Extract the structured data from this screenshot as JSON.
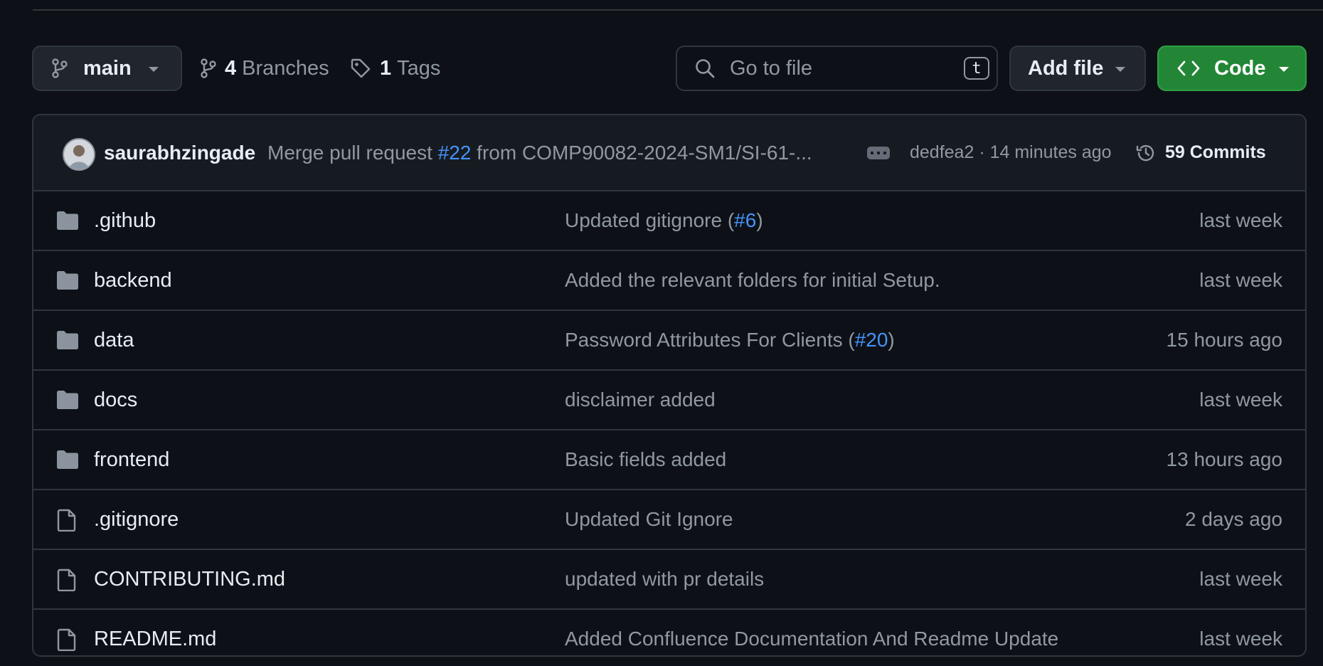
{
  "toolbar": {
    "branch": {
      "label": "main"
    },
    "branches": {
      "count": "4",
      "label": "Branches"
    },
    "tags": {
      "count": "1",
      "label": "Tags"
    },
    "search": {
      "placeholder": "Go to file",
      "shortcut": "t"
    },
    "add_file": {
      "label": "Add file"
    },
    "code": {
      "label": "Code"
    }
  },
  "latest_commit": {
    "author": "saurabhzingade",
    "message_prefix": "Merge pull request ",
    "pr": "#22",
    "message_suffix": " from COMP90082-2024-SM1/SI-61-...",
    "meta": "dedfea2 · 14 minutes ago",
    "commits": "59 Commits"
  },
  "files": [
    {
      "type": "dir",
      "name": ".github",
      "commit_prefix": "Updated gitignore (",
      "pr": "#6",
      "commit_suffix": ")",
      "time": "last week"
    },
    {
      "type": "dir",
      "name": "backend",
      "commit_prefix": "Added the relevant folders for initial Setup.",
      "pr": "",
      "commit_suffix": "",
      "time": "last week"
    },
    {
      "type": "dir",
      "name": "data",
      "commit_prefix": "Password Attributes For Clients (",
      "pr": "#20",
      "commit_suffix": ")",
      "time": "15 hours ago"
    },
    {
      "type": "dir",
      "name": "docs",
      "commit_prefix": "disclaimer added",
      "pr": "",
      "commit_suffix": "",
      "time": "last week"
    },
    {
      "type": "dir",
      "name": "frontend",
      "commit_prefix": "Basic fields added",
      "pr": "",
      "commit_suffix": "",
      "time": "13 hours ago"
    },
    {
      "type": "file",
      "name": ".gitignore",
      "commit_prefix": "Updated Git Ignore",
      "pr": "",
      "commit_suffix": "",
      "time": "2 days ago"
    },
    {
      "type": "file",
      "name": "CONTRIBUTING.md",
      "commit_prefix": "updated with pr details",
      "pr": "",
      "commit_suffix": "",
      "time": "last week"
    },
    {
      "type": "file",
      "name": "README.md",
      "commit_prefix": "Added Confluence Documentation And Readme Update",
      "pr": "",
      "commit_suffix": "",
      "time": "last week"
    }
  ],
  "icons": {
    "branch": "git-branch-icon",
    "tag": "tag-icon",
    "search": "search-icon",
    "code": "code-icon",
    "history": "history-icon",
    "folder": "folder-icon",
    "file": "file-icon"
  },
  "colors": {
    "background": "#0d1117",
    "header_bg": "#161b22",
    "border": "#30363d",
    "text": "#e6edf3",
    "muted": "#9198a1",
    "link": "#4493f8",
    "code_button": "#238636"
  }
}
